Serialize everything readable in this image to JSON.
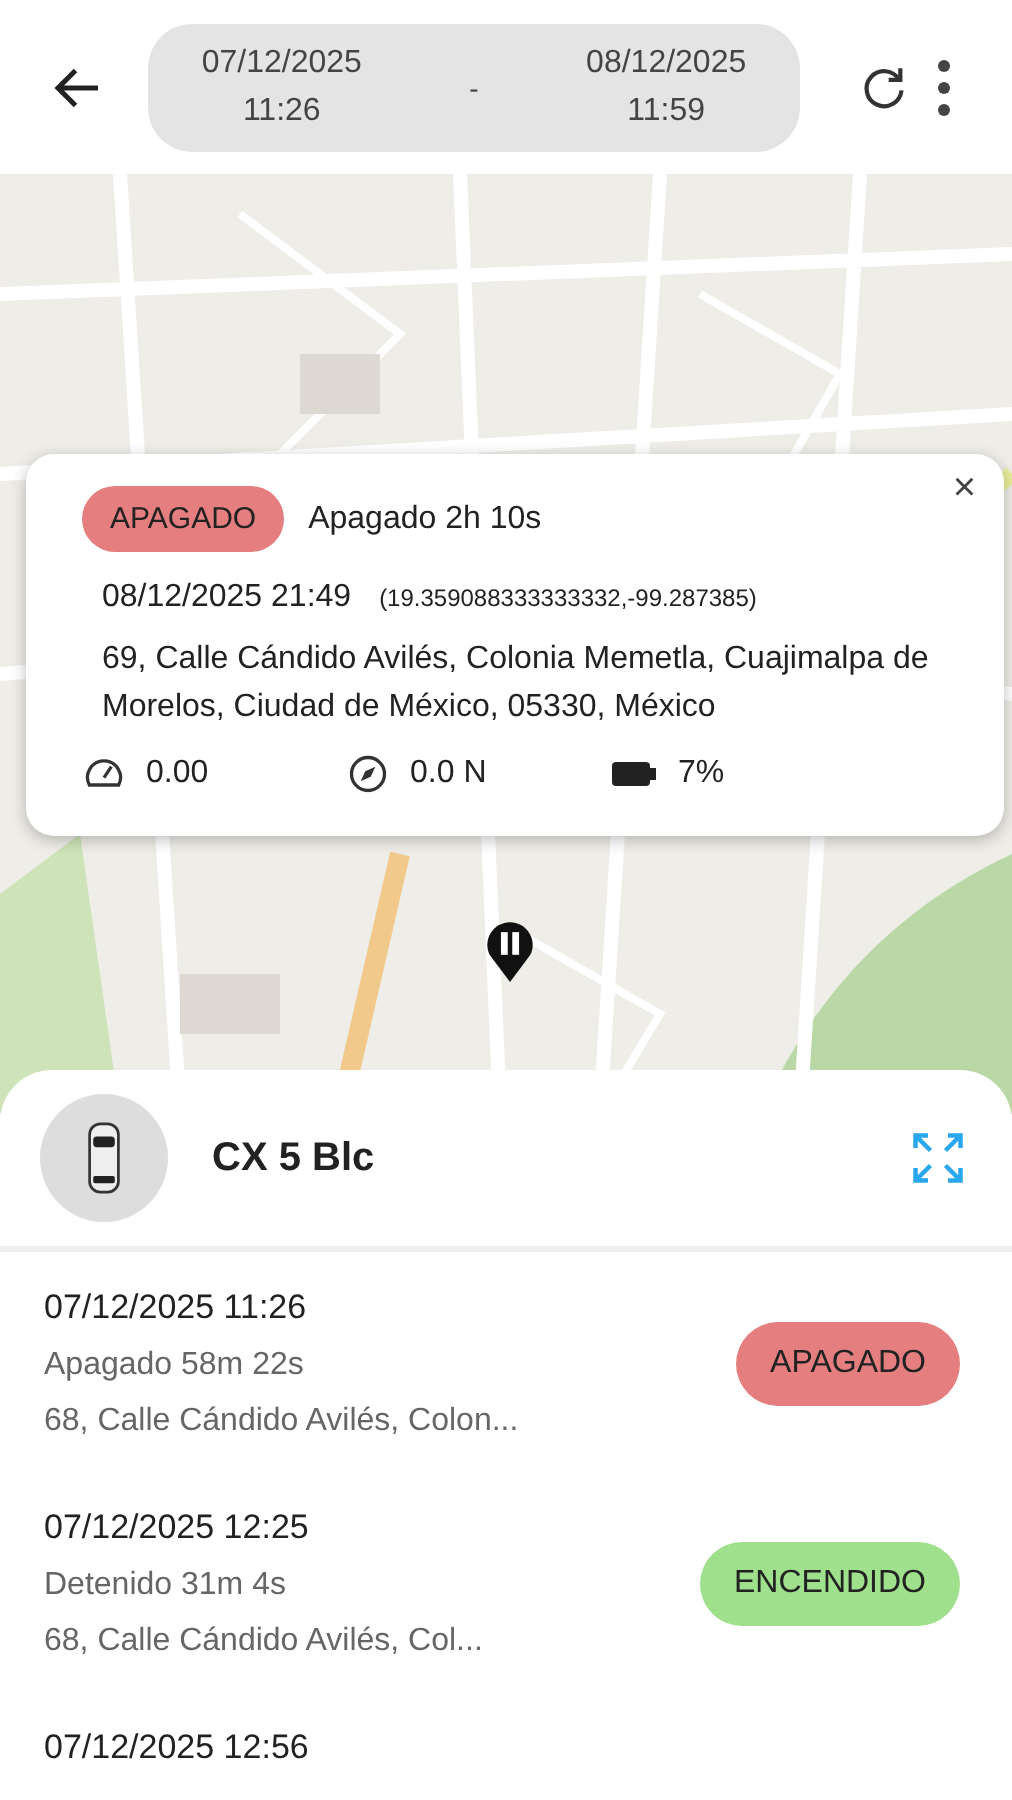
{
  "header": {
    "range_start": {
      "date": "07/12/2025",
      "time": "11:26"
    },
    "separator": "-",
    "range_end": {
      "date": "08/12/2025",
      "time": "11:59"
    }
  },
  "popup": {
    "status": {
      "label": "APAGADO",
      "color": "#e57f7f"
    },
    "duration": "Apagado 2h 10s",
    "close": "×",
    "datetime": "08/12/2025 21:49",
    "coordinates": "(19.359088333333332,-99.287385)",
    "address": "69, Calle Cándido Avilés, Colonia Memetla, Cuajimalpa de Morelos, Ciudad de México, 05330, México",
    "speed": "0.00",
    "heading": "0.0 N",
    "battery": "7%"
  },
  "vehicle": {
    "name": "CX 5 Blc"
  },
  "events": [
    {
      "datetime": "07/12/2025 11:26",
      "duration": "Apagado 58m 22s",
      "address": "68, Calle Cándido Avilés, Colon...",
      "status": {
        "label": "APAGADO",
        "color": "#e57f7f"
      }
    },
    {
      "datetime": "07/12/2025 12:25",
      "duration": "Detenido 31m 4s",
      "address": "68, Calle Cándido Avilés, Col...",
      "status": {
        "label": "ENCENDIDO",
        "color": "#9ee08c"
      }
    },
    {
      "datetime": "07/12/2025 12:56"
    }
  ]
}
